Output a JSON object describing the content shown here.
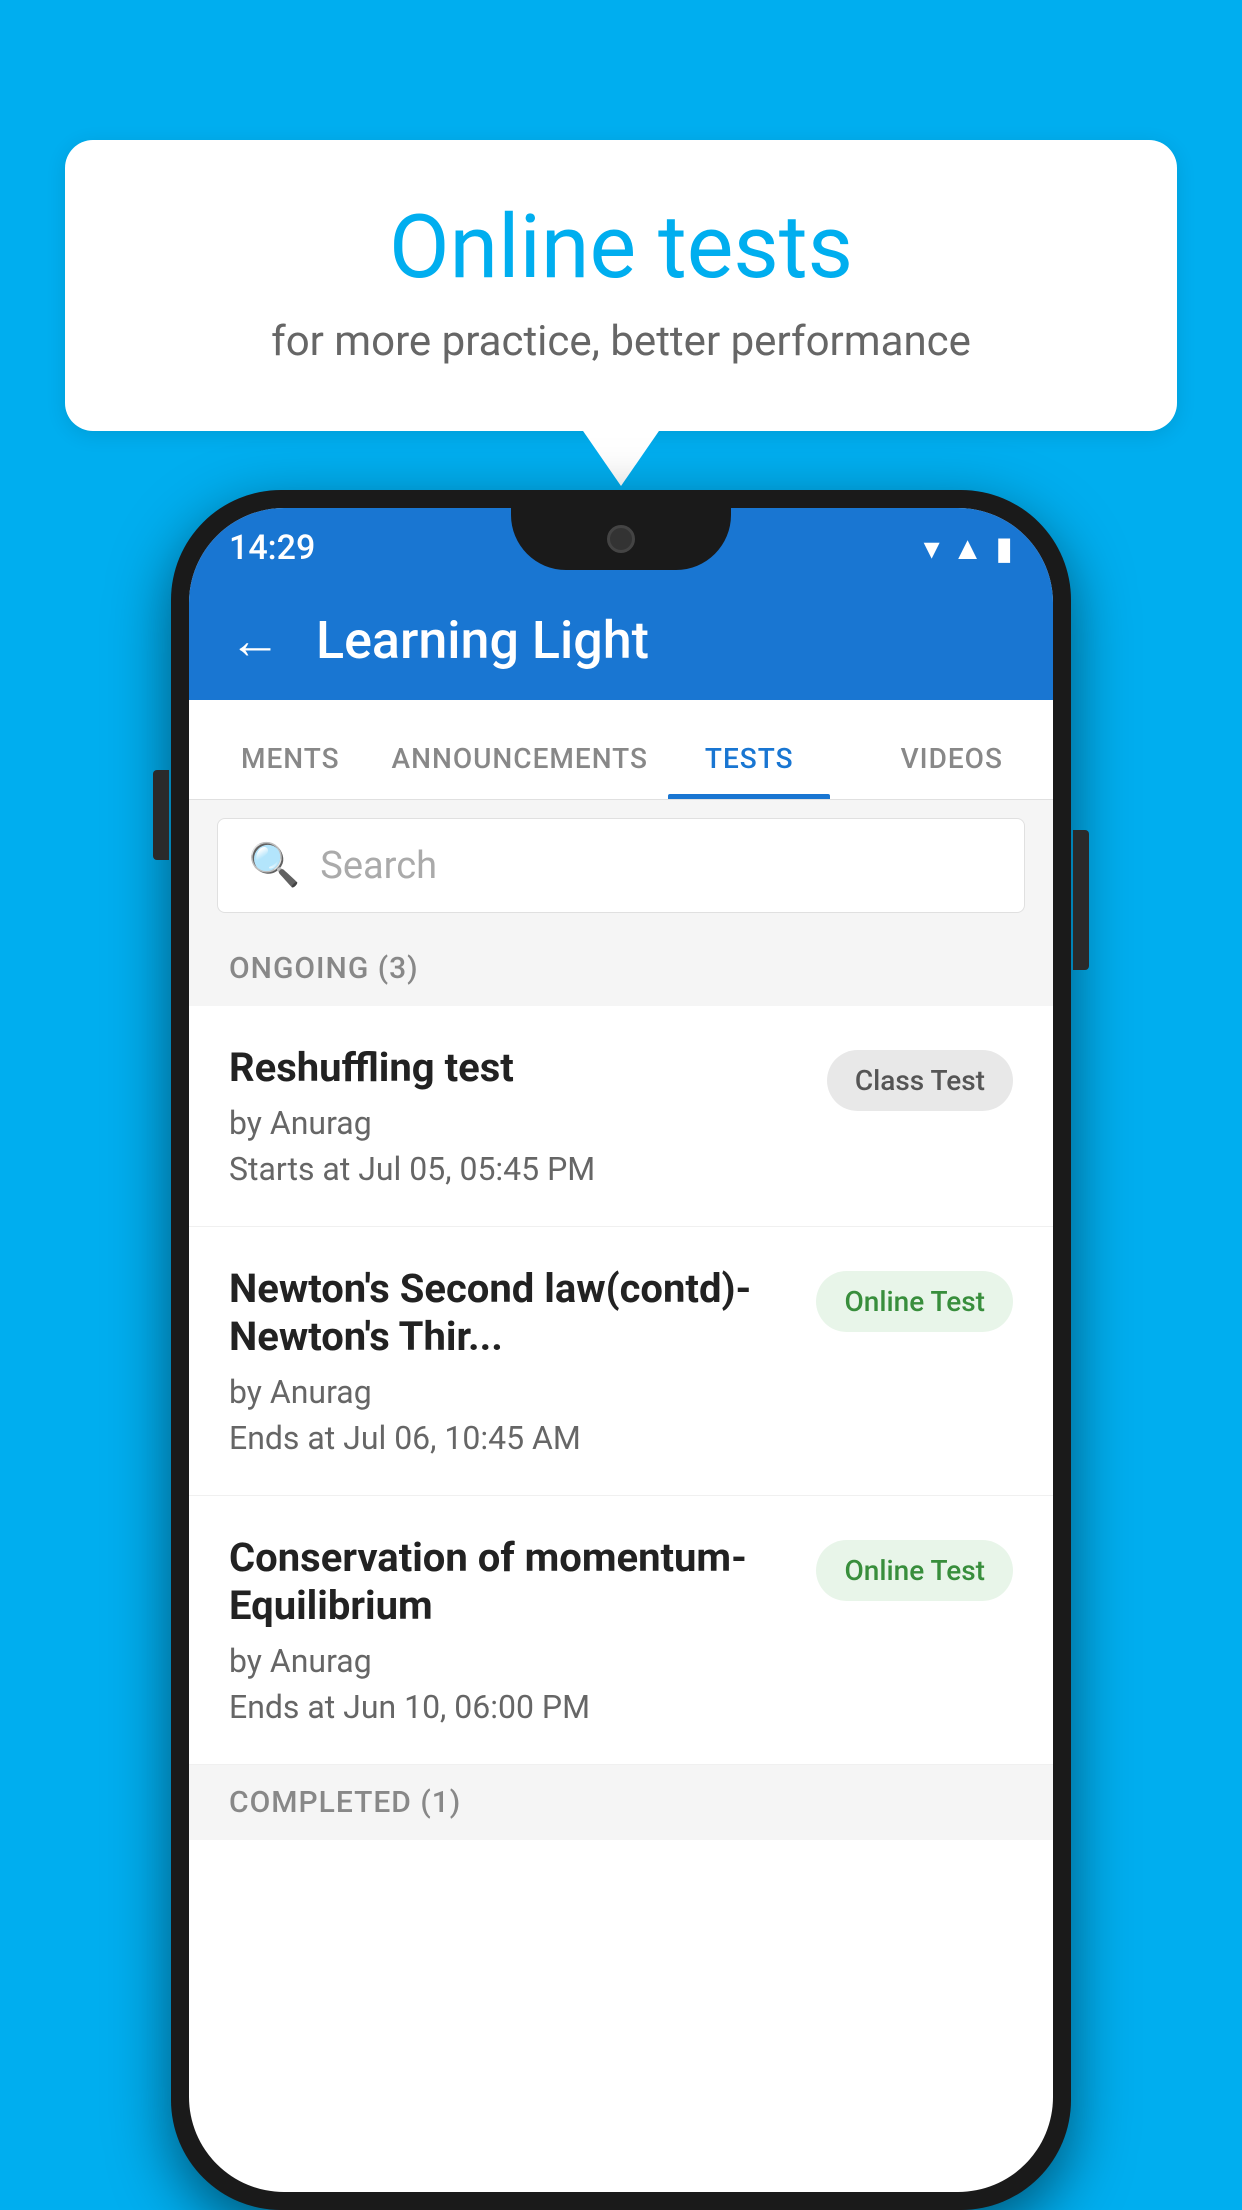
{
  "background": {
    "color": "#00AEEF"
  },
  "speech_bubble": {
    "title": "Online tests",
    "subtitle": "for more practice, better performance"
  },
  "phone": {
    "status_bar": {
      "time": "14:29",
      "icons": [
        "wifi",
        "signal",
        "battery"
      ]
    },
    "app_bar": {
      "title": "Learning Light",
      "back_label": "←"
    },
    "tabs": [
      {
        "label": "MENTS",
        "active": false
      },
      {
        "label": "ANNOUNCEMENTS",
        "active": false
      },
      {
        "label": "TESTS",
        "active": true
      },
      {
        "label": "VIDEOS",
        "active": false
      }
    ],
    "search": {
      "placeholder": "Search"
    },
    "ongoing_section": {
      "label": "ONGOING (3)",
      "tests": [
        {
          "name": "Reshuffling test",
          "by": "by Anurag",
          "time": "Starts at  Jul 05, 05:45 PM",
          "badge": "Class Test",
          "badge_type": "class"
        },
        {
          "name": "Newton's Second law(contd)-Newton's Thir...",
          "by": "by Anurag",
          "time": "Ends at  Jul 06, 10:45 AM",
          "badge": "Online Test",
          "badge_type": "online"
        },
        {
          "name": "Conservation of momentum-Equilibrium",
          "by": "by Anurag",
          "time": "Ends at  Jun 10, 06:00 PM",
          "badge": "Online Test",
          "badge_type": "online"
        }
      ]
    },
    "completed_section": {
      "label": "COMPLETED (1)"
    }
  }
}
